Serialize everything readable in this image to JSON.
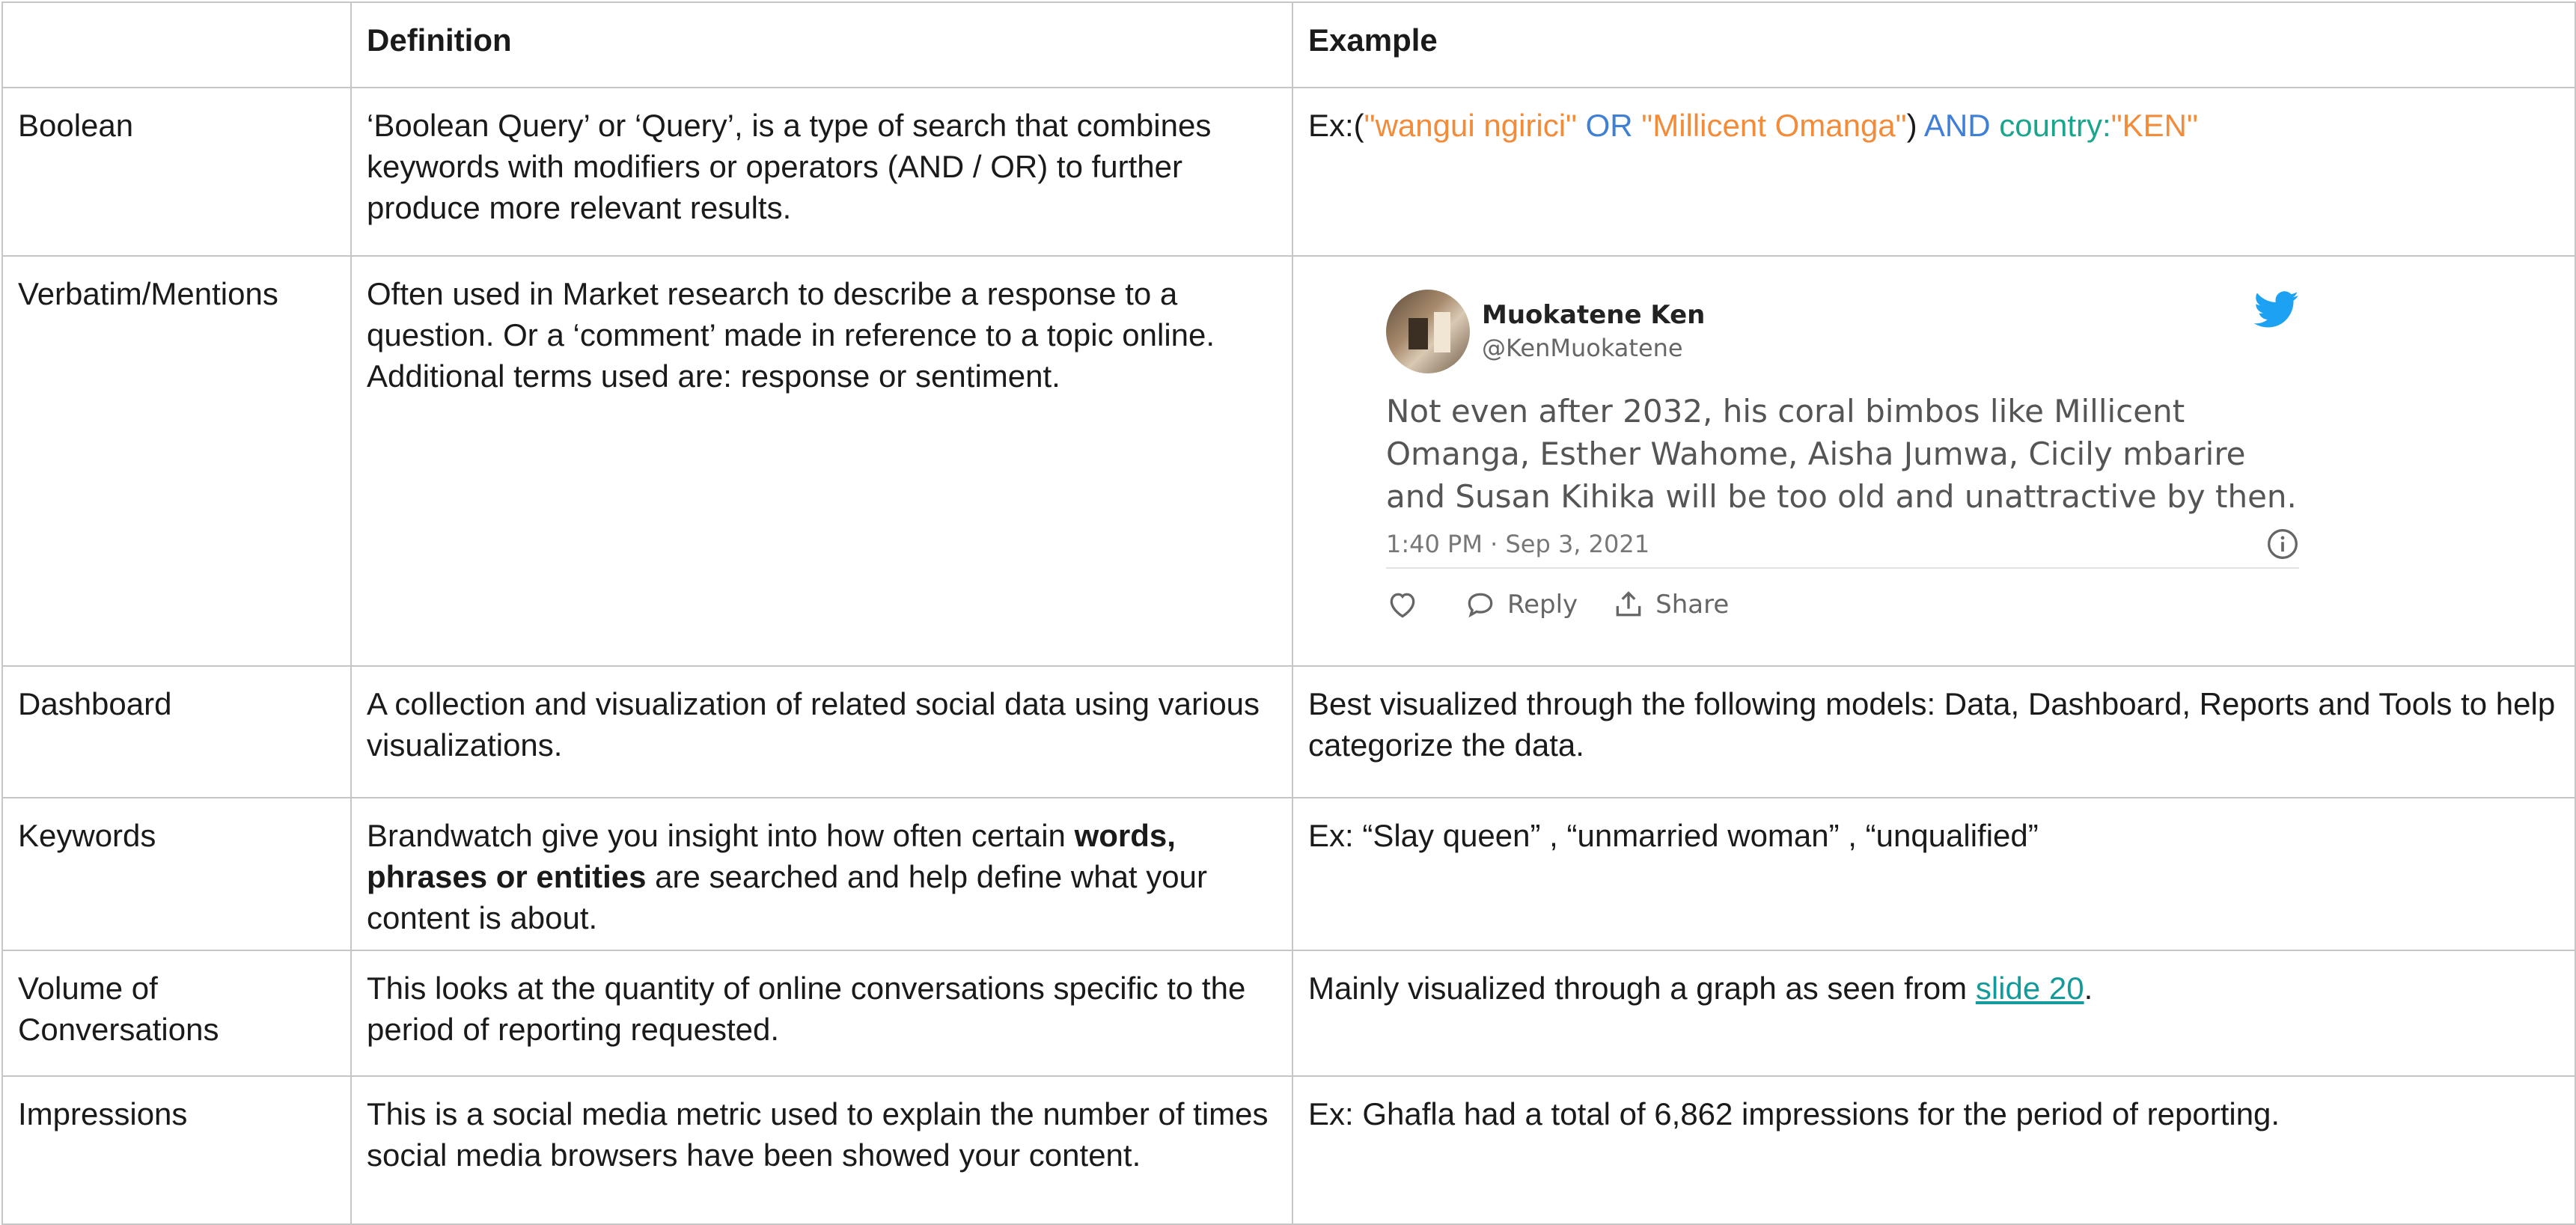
{
  "table": {
    "headers": [
      "",
      "Definition",
      "Example"
    ],
    "rows": [
      {
        "term": "Boolean",
        "definition": "‘Boolean Query’ or ‘Query’, is a type of search that combines keywords with modifiers or operators (AND / OR) to further produce more relevant results.",
        "example_parts": [
          "Ex:(",
          "\"wangui ngirici\"",
          " OR ",
          "\"Millicent Omanga\"",
          ") ",
          "AND ",
          "country:",
          "\"KEN\""
        ]
      },
      {
        "term": "Verbatim/Mentions",
        "definition": "Often used in Market research to describe a response to a question. Or a ‘comment’ made in reference to a topic online. Additional terms used are: response or sentiment."
      },
      {
        "term": "Dashboard",
        "definition": "A collection and visualization of related social data using various visualizations.",
        "example": "Best visualized through the following models: Data, Dashboard, Reports and Tools to help categorize the data."
      },
      {
        "term": "Keywords",
        "definition_before": "Brandwatch give you insight into how often certain ",
        "definition_bold": "words, phrases or entities",
        "definition_after": " are searched and help define what your content is about.",
        "example": "Ex: “Slay queen” , “unmarried woman” , “unqualified”"
      },
      {
        "term": "Volume of Conversations",
        "definition": "This looks at the quantity of online conversations specific to the period of reporting requested.",
        "example_before": "Mainly visualized through a graph as seen from ",
        "example_link": "slide 20",
        "example_after": "."
      },
      {
        "term": "Impressions",
        "definition": "This is a social media metric used to explain the number of times social media browsers have been showed your content.",
        "example": "Ex: Ghafla had a total of 6,862 impressions for the period of reporting."
      }
    ]
  },
  "tweet": {
    "display_name": "Muokatene Ken",
    "handle": "@KenMuokatene",
    "text": "Not even after 2032, his coral bimbos like Millicent Omanga, Esther Wahome, Aisha Jumwa, Cicily mbarire and Susan Kihika will be too old and unattractive by then.",
    "timestamp": "1:40 PM · Sep 3, 2021",
    "reply_label": "Reply",
    "share_label": "Share",
    "icons": [
      "twitter-bird-icon",
      "info-icon",
      "heart-icon",
      "reply-bubble-icon",
      "share-icon"
    ],
    "colors": {
      "bird": "#1da1f2"
    }
  },
  "colors": {
    "query_orange": "#f28c3a",
    "query_blue": "#3f7fd6",
    "query_green": "#1aa58c",
    "link": "#159a9c",
    "border": "#c6c6c6"
  }
}
